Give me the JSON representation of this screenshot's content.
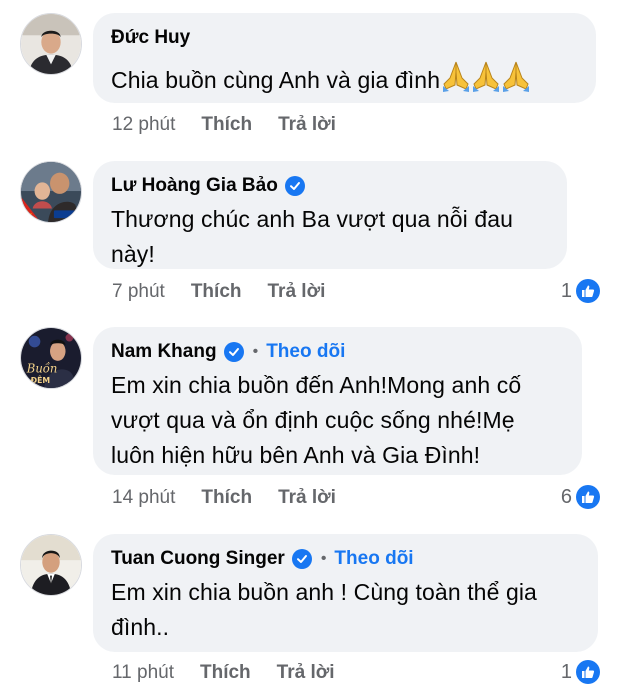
{
  "comments": [
    {
      "name": "Đức Huy",
      "verified": false,
      "follow": "",
      "text": "Chia buồn cùng Anh và gia đình",
      "emoji": "folded-hands-icon x3",
      "time": "12 phút",
      "like_label": "Thích",
      "reply_label": "Trả lời",
      "reactions": ""
    },
    {
      "name": "Lư Hoàng Gia Bảo",
      "verified": true,
      "follow": "",
      "text_lines": [
        "Thương chúc anh Ba vượt qua nỗi đau",
        "này!"
      ],
      "time": "7 phút",
      "like_label": "Thích",
      "reply_label": "Trả lời",
      "reactions": "1"
    },
    {
      "name": "Nam Khang",
      "verified": true,
      "follow": "Theo dõi",
      "text_lines": [
        "Em xin chia buồn đến Anh!Mong anh cố",
        "vượt qua và ổn định cuộc sống nhé!Mẹ",
        "luôn hiện hữu bên Anh và Gia Đình!"
      ],
      "time": "14 phút",
      "like_label": "Thích",
      "reply_label": "Trả lời",
      "reactions": "6"
    },
    {
      "name": "Tuan Cuong Singer",
      "verified": true,
      "follow": "Theo dõi",
      "text_lines": [
        "Em xin chia buồn anh ! Cùng toàn thể gia",
        "đình.."
      ],
      "time": "11 phút",
      "like_label": "Thích",
      "reply_label": "Trả lời",
      "reactions": "1"
    }
  ],
  "colors": {
    "bubble": "#f0f2f5",
    "accent": "#1877f2",
    "secondary_text": "#65676b",
    "primary_text": "#050505"
  }
}
